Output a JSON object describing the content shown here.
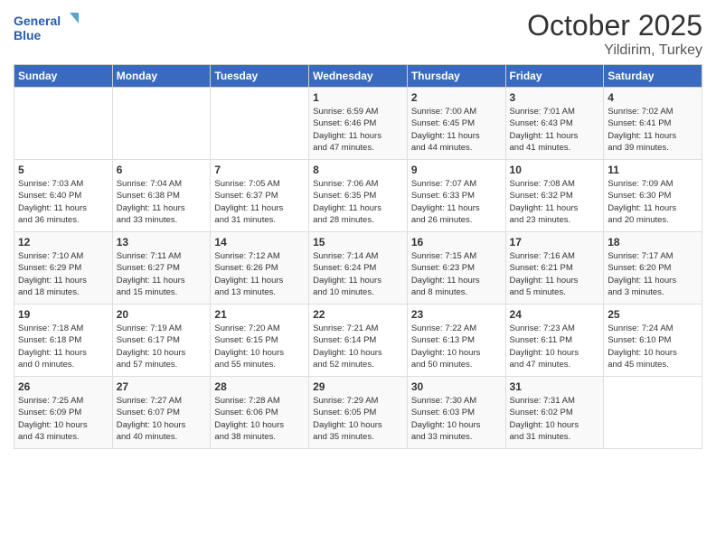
{
  "header": {
    "logo_line1": "General",
    "logo_line2": "Blue",
    "month": "October 2025",
    "location": "Yildirim, Turkey"
  },
  "weekdays": [
    "Sunday",
    "Monday",
    "Tuesday",
    "Wednesday",
    "Thursday",
    "Friday",
    "Saturday"
  ],
  "weeks": [
    [
      {
        "day": "",
        "content": ""
      },
      {
        "day": "",
        "content": ""
      },
      {
        "day": "",
        "content": ""
      },
      {
        "day": "1",
        "content": "Sunrise: 6:59 AM\nSunset: 6:46 PM\nDaylight: 11 hours\nand 47 minutes."
      },
      {
        "day": "2",
        "content": "Sunrise: 7:00 AM\nSunset: 6:45 PM\nDaylight: 11 hours\nand 44 minutes."
      },
      {
        "day": "3",
        "content": "Sunrise: 7:01 AM\nSunset: 6:43 PM\nDaylight: 11 hours\nand 41 minutes."
      },
      {
        "day": "4",
        "content": "Sunrise: 7:02 AM\nSunset: 6:41 PM\nDaylight: 11 hours\nand 39 minutes."
      }
    ],
    [
      {
        "day": "5",
        "content": "Sunrise: 7:03 AM\nSunset: 6:40 PM\nDaylight: 11 hours\nand 36 minutes."
      },
      {
        "day": "6",
        "content": "Sunrise: 7:04 AM\nSunset: 6:38 PM\nDaylight: 11 hours\nand 33 minutes."
      },
      {
        "day": "7",
        "content": "Sunrise: 7:05 AM\nSunset: 6:37 PM\nDaylight: 11 hours\nand 31 minutes."
      },
      {
        "day": "8",
        "content": "Sunrise: 7:06 AM\nSunset: 6:35 PM\nDaylight: 11 hours\nand 28 minutes."
      },
      {
        "day": "9",
        "content": "Sunrise: 7:07 AM\nSunset: 6:33 PM\nDaylight: 11 hours\nand 26 minutes."
      },
      {
        "day": "10",
        "content": "Sunrise: 7:08 AM\nSunset: 6:32 PM\nDaylight: 11 hours\nand 23 minutes."
      },
      {
        "day": "11",
        "content": "Sunrise: 7:09 AM\nSunset: 6:30 PM\nDaylight: 11 hours\nand 20 minutes."
      }
    ],
    [
      {
        "day": "12",
        "content": "Sunrise: 7:10 AM\nSunset: 6:29 PM\nDaylight: 11 hours\nand 18 minutes."
      },
      {
        "day": "13",
        "content": "Sunrise: 7:11 AM\nSunset: 6:27 PM\nDaylight: 11 hours\nand 15 minutes."
      },
      {
        "day": "14",
        "content": "Sunrise: 7:12 AM\nSunset: 6:26 PM\nDaylight: 11 hours\nand 13 minutes."
      },
      {
        "day": "15",
        "content": "Sunrise: 7:14 AM\nSunset: 6:24 PM\nDaylight: 11 hours\nand 10 minutes."
      },
      {
        "day": "16",
        "content": "Sunrise: 7:15 AM\nSunset: 6:23 PM\nDaylight: 11 hours\nand 8 minutes."
      },
      {
        "day": "17",
        "content": "Sunrise: 7:16 AM\nSunset: 6:21 PM\nDaylight: 11 hours\nand 5 minutes."
      },
      {
        "day": "18",
        "content": "Sunrise: 7:17 AM\nSunset: 6:20 PM\nDaylight: 11 hours\nand 3 minutes."
      }
    ],
    [
      {
        "day": "19",
        "content": "Sunrise: 7:18 AM\nSunset: 6:18 PM\nDaylight: 11 hours\nand 0 minutes."
      },
      {
        "day": "20",
        "content": "Sunrise: 7:19 AM\nSunset: 6:17 PM\nDaylight: 10 hours\nand 57 minutes."
      },
      {
        "day": "21",
        "content": "Sunrise: 7:20 AM\nSunset: 6:15 PM\nDaylight: 10 hours\nand 55 minutes."
      },
      {
        "day": "22",
        "content": "Sunrise: 7:21 AM\nSunset: 6:14 PM\nDaylight: 10 hours\nand 52 minutes."
      },
      {
        "day": "23",
        "content": "Sunrise: 7:22 AM\nSunset: 6:13 PM\nDaylight: 10 hours\nand 50 minutes."
      },
      {
        "day": "24",
        "content": "Sunrise: 7:23 AM\nSunset: 6:11 PM\nDaylight: 10 hours\nand 47 minutes."
      },
      {
        "day": "25",
        "content": "Sunrise: 7:24 AM\nSunset: 6:10 PM\nDaylight: 10 hours\nand 45 minutes."
      }
    ],
    [
      {
        "day": "26",
        "content": "Sunrise: 7:25 AM\nSunset: 6:09 PM\nDaylight: 10 hours\nand 43 minutes."
      },
      {
        "day": "27",
        "content": "Sunrise: 7:27 AM\nSunset: 6:07 PM\nDaylight: 10 hours\nand 40 minutes."
      },
      {
        "day": "28",
        "content": "Sunrise: 7:28 AM\nSunset: 6:06 PM\nDaylight: 10 hours\nand 38 minutes."
      },
      {
        "day": "29",
        "content": "Sunrise: 7:29 AM\nSunset: 6:05 PM\nDaylight: 10 hours\nand 35 minutes."
      },
      {
        "day": "30",
        "content": "Sunrise: 7:30 AM\nSunset: 6:03 PM\nDaylight: 10 hours\nand 33 minutes."
      },
      {
        "day": "31",
        "content": "Sunrise: 7:31 AM\nSunset: 6:02 PM\nDaylight: 10 hours\nand 31 minutes."
      },
      {
        "day": "",
        "content": ""
      }
    ]
  ]
}
